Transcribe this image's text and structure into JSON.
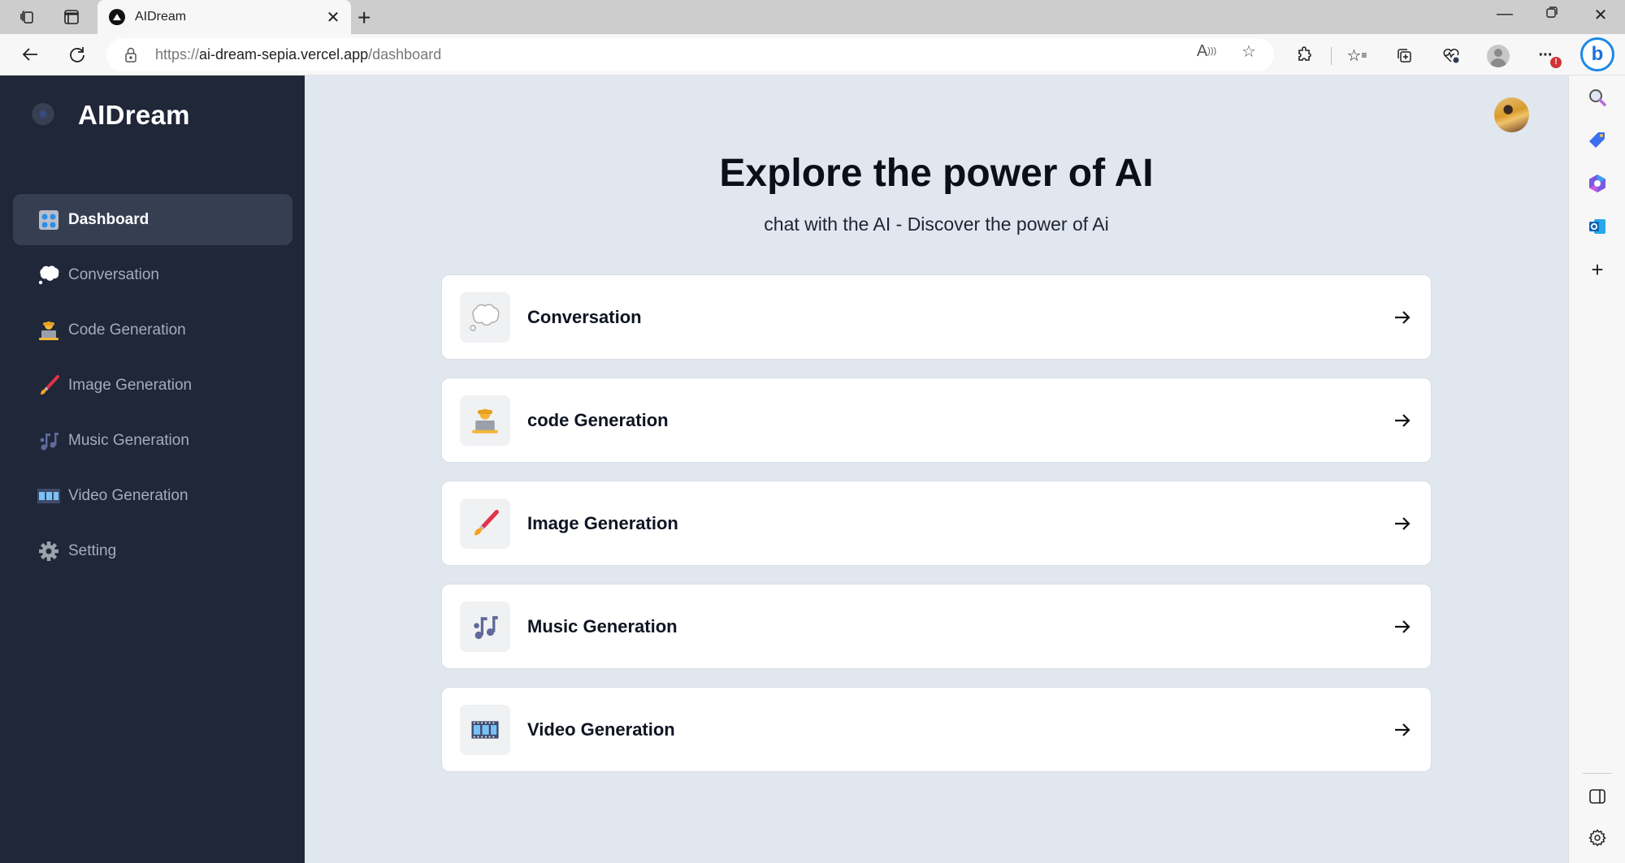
{
  "browser": {
    "tab_title": "AIDream",
    "url_scheme": "https://",
    "url_host": "ai-dream-sepia.vercel.app",
    "url_path": "/dashboard",
    "notification_badge": "!"
  },
  "sidebar": {
    "brand": "AIDream",
    "items": [
      {
        "label": "Dashboard",
        "icon": "dashboard-icon",
        "emoji": "🎛️",
        "active": true
      },
      {
        "label": "Conversation",
        "icon": "thought-bubble-icon",
        "emoji": "💭",
        "active": false
      },
      {
        "label": "Code Generation",
        "icon": "technologist-icon",
        "emoji": "🧑‍💻",
        "active": false
      },
      {
        "label": "Image Generation",
        "icon": "paintbrush-icon",
        "emoji": "🖌️",
        "active": false
      },
      {
        "label": "Music Generation",
        "icon": "music-notes-icon",
        "emoji": "🎶",
        "active": false
      },
      {
        "label": "Video Generation",
        "icon": "film-frames-icon",
        "emoji": "🎞️",
        "active": false
      },
      {
        "label": "Setting",
        "icon": "gear-icon",
        "emoji": "⚙️",
        "active": false
      }
    ]
  },
  "main": {
    "title": "Explore the power of AI",
    "subtitle": "chat with the AI - Discover the power of Ai",
    "cards": [
      {
        "label": "Conversation",
        "icon": "thought-bubble-icon",
        "emoji": "💭"
      },
      {
        "label": "code Generation",
        "icon": "technologist-icon",
        "emoji": "🧑‍💻"
      },
      {
        "label": "Image Generation",
        "icon": "paintbrush-icon",
        "emoji": "🖌️"
      },
      {
        "label": "Music Generation",
        "icon": "music-notes-icon",
        "emoji": "🎶"
      },
      {
        "label": "Video Generation",
        "icon": "film-frames-icon",
        "emoji": "🎞️"
      }
    ]
  },
  "colors": {
    "sidebar_bg": "#1f2738",
    "sidebar_active": "#363f51",
    "main_bg": "#e1e7ef",
    "card_bg": "#ffffff"
  }
}
